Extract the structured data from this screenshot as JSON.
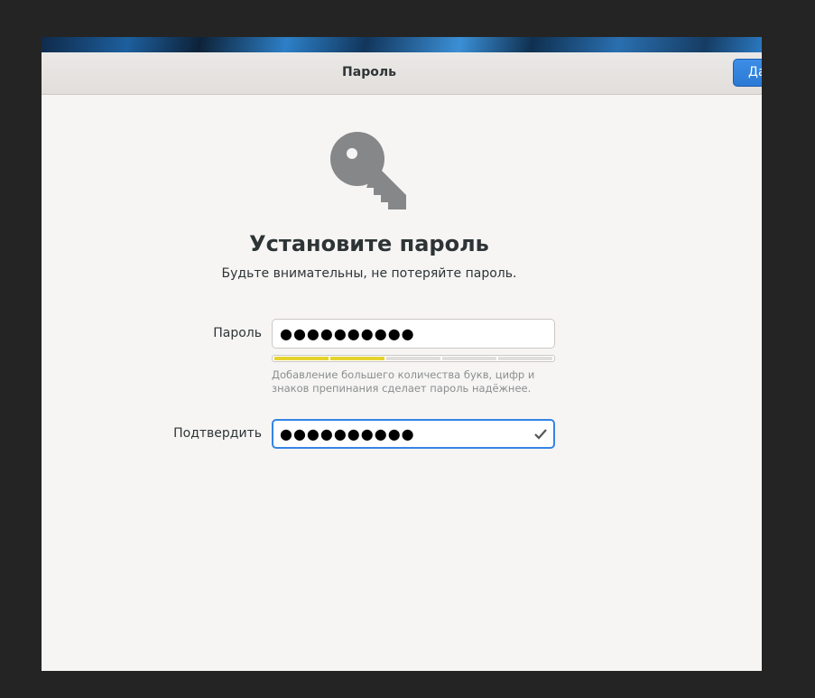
{
  "window": {
    "title": "Пароль",
    "next_label": "Да"
  },
  "main": {
    "icon": "key-icon",
    "title": "Установите пароль",
    "subtitle": "Будьте внимательны, не потеряйте пароль.",
    "password": {
      "label": "Пароль",
      "value": "●●●●●●●●●●"
    },
    "strength": {
      "segments": 5,
      "filled": 2,
      "level": 0.4,
      "color": "#e5d32e"
    },
    "hint": "Добавление большего количества букв, цифр и знаков препинания сделает пароль надёжнее.",
    "confirm": {
      "label": "Подтвердить",
      "value": "●●●●●●●●●●",
      "status_icon": "check-icon"
    }
  },
  "colors": {
    "accent": "#3584e4",
    "background": "#f6f5f4",
    "text": "#2e3436"
  }
}
